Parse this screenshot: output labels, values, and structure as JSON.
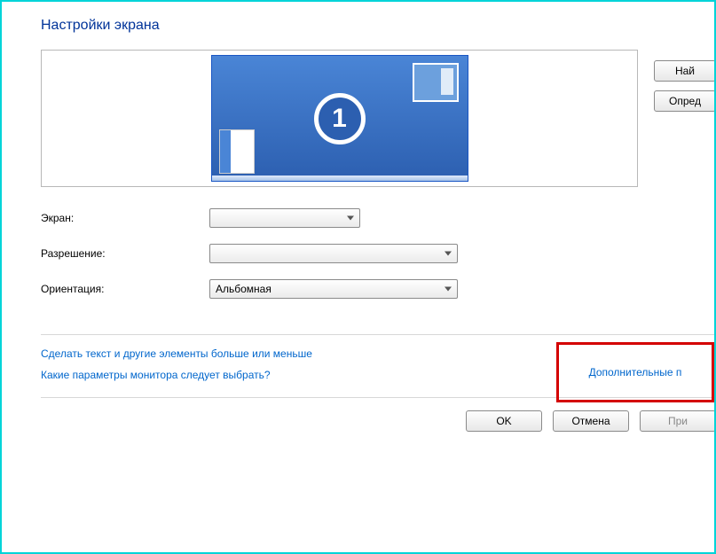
{
  "title": "Настройки экрана",
  "monitor_number": "1",
  "side_buttons": {
    "find": "Най",
    "identify": "Опред"
  },
  "labels": {
    "screen": "Экран:",
    "resolution": "Разрешение:",
    "orientation": "Ориентация:"
  },
  "values": {
    "screen": "",
    "resolution": "",
    "orientation": "Альбомная"
  },
  "links": {
    "advanced": "Дополнительные п",
    "text_size": "Сделать текст и другие элементы больше или меньше",
    "which_params": "Какие параметры монитора следует выбрать?"
  },
  "footer": {
    "ok": "OK",
    "cancel": "Отмена",
    "apply": "При"
  }
}
